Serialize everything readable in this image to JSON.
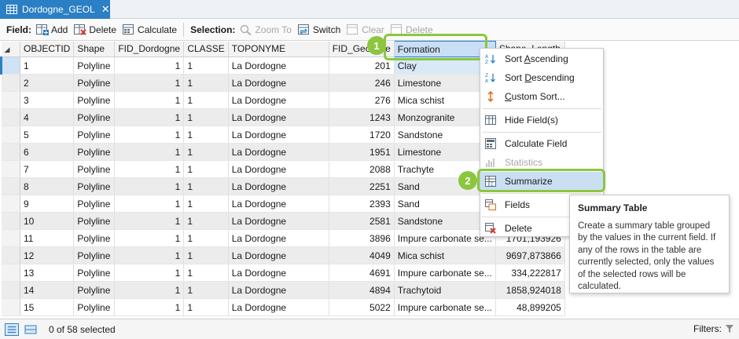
{
  "tab": {
    "label": "Dordogne_GEOL",
    "close": "✕"
  },
  "toolbar": {
    "field_label": "Field:",
    "add": "Add",
    "delete": "Delete",
    "calculate": "Calculate",
    "selection_label": "Selection:",
    "zoom_to": "Zoom To",
    "switch": "Switch",
    "clear": "Clear",
    "delete_sel": "Delete"
  },
  "columns": [
    "OBJECTID",
    "Shape",
    "FID_Dordogne",
    "CLASSE",
    "TOPONYME",
    "FID_Geologie",
    "Formation",
    "Shape_Length"
  ],
  "rows": [
    [
      "1",
      "Polyline",
      "1",
      "1",
      "La Dordogne",
      "201",
      "Clay",
      ""
    ],
    [
      "2",
      "Polyline",
      "1",
      "1",
      "La Dordogne",
      "246",
      "Limestone",
      ""
    ],
    [
      "3",
      "Polyline",
      "1",
      "1",
      "La Dordogne",
      "276",
      "Mica schist",
      ""
    ],
    [
      "4",
      "Polyline",
      "1",
      "1",
      "La Dordogne",
      "1243",
      "Monzogranite",
      ""
    ],
    [
      "5",
      "Polyline",
      "1",
      "1",
      "La Dordogne",
      "1720",
      "Sandstone",
      ""
    ],
    [
      "6",
      "Polyline",
      "1",
      "1",
      "La Dordogne",
      "1951",
      "Limestone",
      ""
    ],
    [
      "7",
      "Polyline",
      "1",
      "1",
      "La Dordogne",
      "2088",
      "Trachyte",
      ""
    ],
    [
      "8",
      "Polyline",
      "1",
      "1",
      "La Dordogne",
      "2251",
      "Sand",
      ""
    ],
    [
      "9",
      "Polyline",
      "1",
      "1",
      "La Dordogne",
      "2393",
      "Sand",
      ""
    ],
    [
      "10",
      "Polyline",
      "1",
      "1",
      "La Dordogne",
      "2581",
      "Sandstone",
      ""
    ],
    [
      "11",
      "Polyline",
      "1",
      "1",
      "La Dordogne",
      "3896",
      "Impure carbonate se...",
      "1701,193926"
    ],
    [
      "12",
      "Polyline",
      "1",
      "1",
      "La Dordogne",
      "4049",
      "Mica schist",
      "9697,873866"
    ],
    [
      "13",
      "Polyline",
      "1",
      "1",
      "La Dordogne",
      "4691",
      "Impure carbonate se...",
      "334,222817"
    ],
    [
      "14",
      "Polyline",
      "1",
      "1",
      "La Dordogne",
      "4894",
      "Trachytoid",
      "1858,924018"
    ],
    [
      "15",
      "Polyline",
      "1",
      "1",
      "La Dordogne",
      "5022",
      "Impure carbonate se...",
      "48,899205"
    ]
  ],
  "context_menu": {
    "sort_asc": "Sort Ascending",
    "sort_desc": "Sort Descending",
    "custom_sort": "Custom Sort...",
    "hide_fields": "Hide Field(s)",
    "calculate_field": "Calculate Field",
    "statistics": "Statistics",
    "summarize": "Summarize",
    "fields": "Fields",
    "delete": "Delete"
  },
  "callouts": {
    "one": "1",
    "two": "2"
  },
  "tooltip": {
    "title": "Summary Table",
    "body": "Create a summary table grouped by the values in the current field. If any of the rows in the table are currently selected, only the values of the selected rows will be calculated."
  },
  "status": {
    "count": "0 of 58 selected",
    "filters": "Filters:"
  },
  "colors": {
    "accent": "#2b7fc4",
    "highlight": "#8cc63f",
    "menu_hover": "#cbdff3"
  }
}
